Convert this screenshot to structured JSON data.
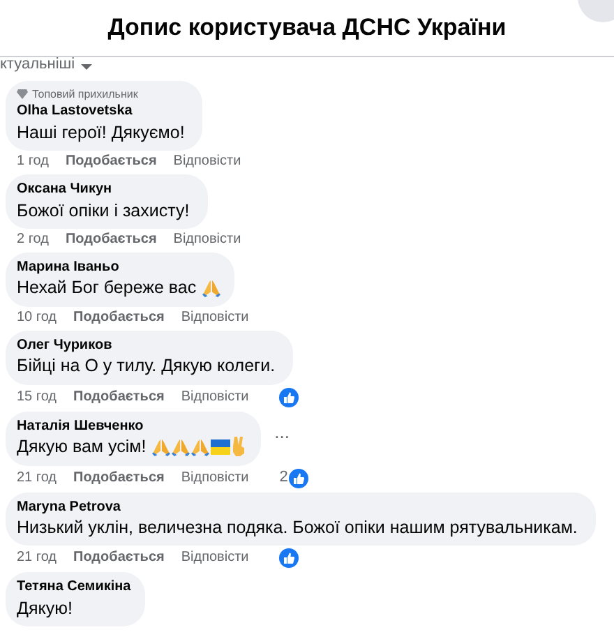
{
  "header": {
    "title": "Допис користувача ДСНС України"
  },
  "sort": {
    "label": "ктуальніші"
  },
  "comments": [
    {
      "badge": "Топовий прихильник",
      "author": "Olha Lastovetska",
      "text": "Наші герої! Дякуємо!",
      "time": "1 год",
      "like": "Подобається",
      "reply": "Відповісти",
      "reactions": false
    },
    {
      "author": "Оксана Чикун",
      "text": "Божої опіки і захисту!",
      "time": "2 год",
      "like": "Подобається",
      "reply": "Відповісти",
      "reactions": false
    },
    {
      "author": "Марина Іваньо",
      "text": "Нехай Бог береже вас",
      "emojis": [
        {
          "kind": "pray"
        }
      ],
      "time": "10 год",
      "like": "Подобається",
      "reply": "Відповісти",
      "reactions": false
    },
    {
      "author": "Олег Чуриков",
      "text": "Бійці на О у тилу. Дякую колеги.",
      "time": "15 год",
      "like": "Подобається",
      "reply": "Відповісти",
      "reactions": true
    },
    {
      "author": "Наталія Шевченко",
      "text": "Дякую вам усім!",
      "emojis": [
        {
          "kind": "pray"
        },
        {
          "kind": "pray"
        },
        {
          "kind": "pray"
        },
        {
          "kind": "flag"
        },
        {
          "kind": "victory"
        }
      ],
      "menu": "...",
      "time": "21 год",
      "like": "Подобається",
      "reply": "Відповісти",
      "reactions": true,
      "reaction_count": "2"
    },
    {
      "author": "Maryna Petrova",
      "text": "Низький уклін, величезна подяка. Божої опіки нашим рятувальникам.",
      "time": "21 год",
      "like": "Подобається",
      "reply": "Відповісти",
      "reactions": true
    },
    {
      "author": "Тетяна Семикіна",
      "text": "Дякую!"
    }
  ]
}
